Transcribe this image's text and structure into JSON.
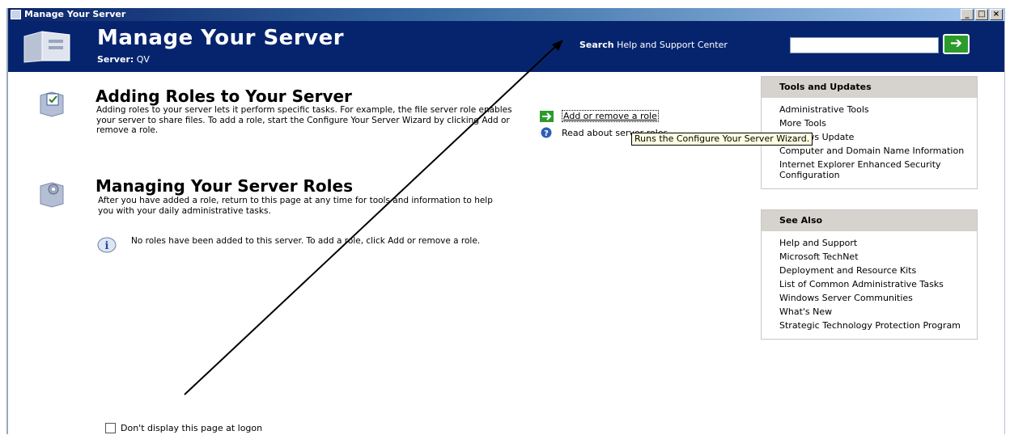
{
  "window": {
    "title": "Manage Your Server",
    "controls": {
      "minimize": "_",
      "maximize": "□",
      "close": "×"
    }
  },
  "header": {
    "title": "Manage Your Server",
    "server_label": "Server:",
    "server_name": "QV",
    "search_label_bold": "Search",
    "search_label_rest": "Help and Support Center",
    "search_value": "",
    "go_icon": "green-arrow-icon"
  },
  "sections": {
    "adding": {
      "title": "Adding Roles to Your Server",
      "text": "Adding roles to your server lets it perform specific tasks. For example, the file server role enables your server to share files. To add a role, start the Configure Your Server Wizard by clicking Add or remove a role."
    },
    "managing": {
      "title": "Managing Your Server Roles",
      "text": "After you have added a role, return to this page at any time for tools and information to help you with your daily administrative tasks.",
      "info": "No roles have been added to this server. To add a role, click Add or remove a role."
    }
  },
  "actions": {
    "add_remove": "Add or remove a role",
    "read_about": "Read about server roles"
  },
  "tooltip": "Runs the Configure Your Server Wizard.",
  "tools_panel": {
    "heading": "Tools and Updates",
    "items": [
      "Administrative Tools",
      "More Tools",
      "Windows Update",
      "Computer and Domain Name Information",
      "Internet Explorer Enhanced Security Configuration"
    ]
  },
  "see_also_panel": {
    "heading": "See Also",
    "items": [
      "Help and Support",
      "Microsoft TechNet",
      "Deployment and Resource Kits",
      "List of Common Administrative Tasks",
      "Windows Server Communities",
      "What's New",
      "Strategic Technology Protection Program"
    ]
  },
  "footer": {
    "checkbox_label": "Don't display this page at logon",
    "checked": false
  },
  "colors": {
    "header_bg": "#06246e",
    "panel_head_bg": "#d6d3ce",
    "tooltip_bg": "#ffffe1",
    "go_button": "#2c9b2c"
  }
}
